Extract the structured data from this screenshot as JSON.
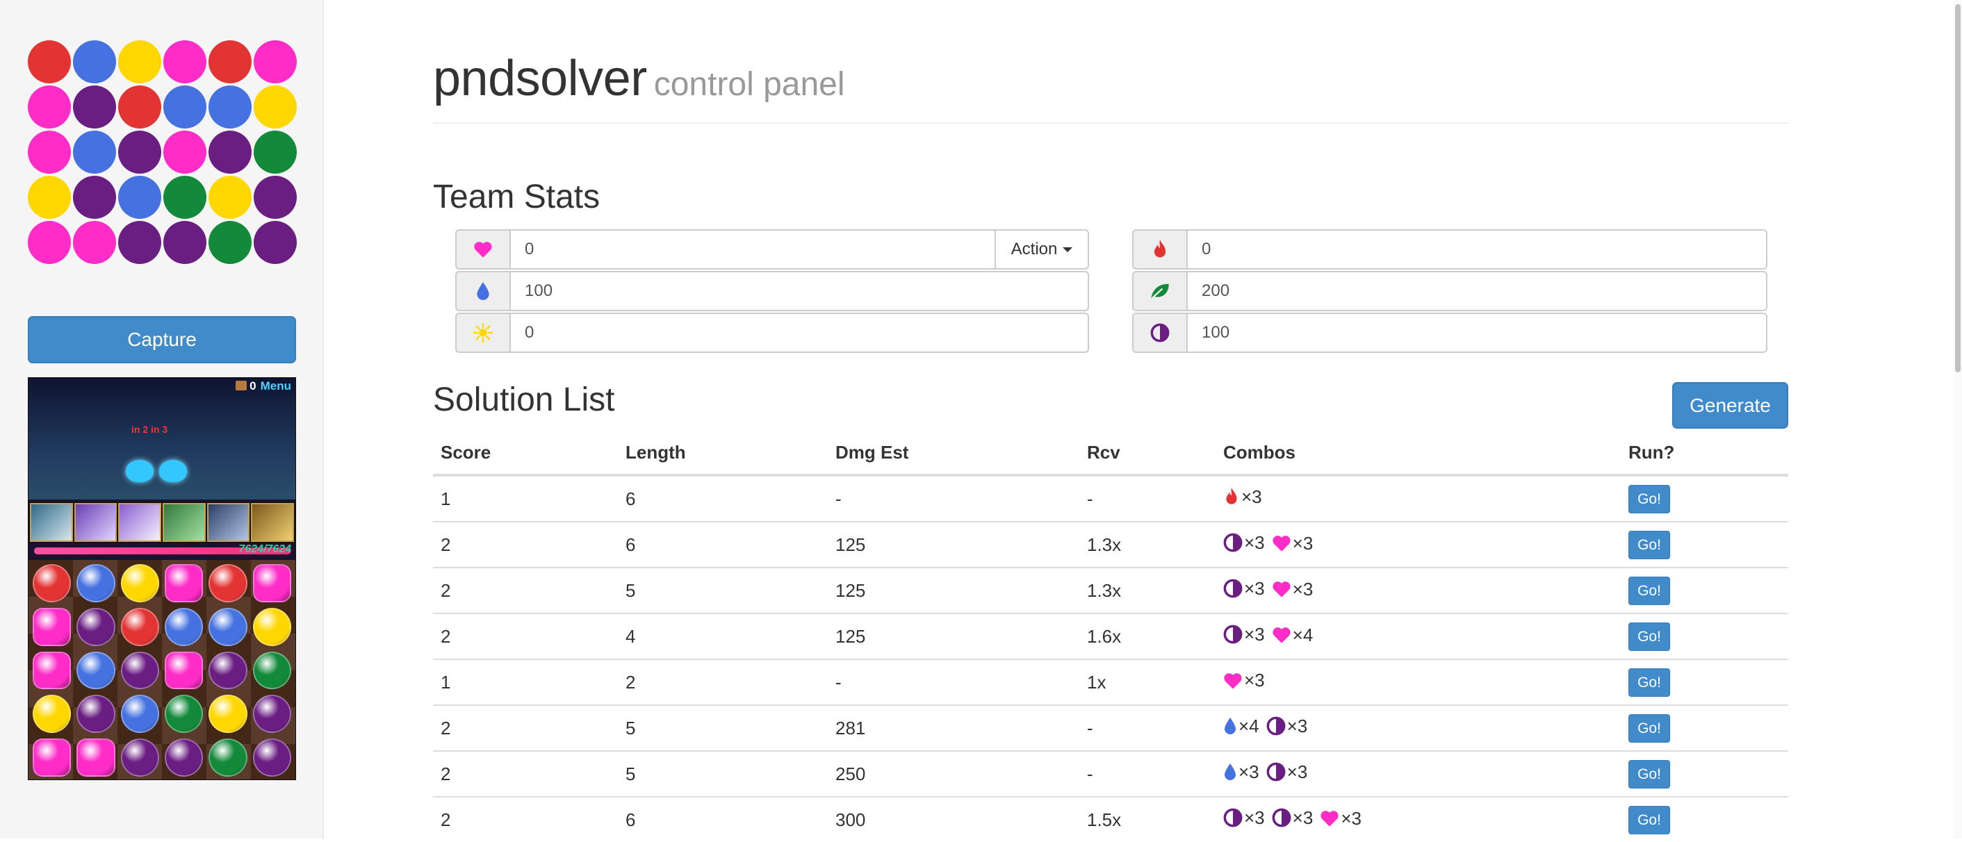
{
  "sidebar": {
    "orb_colors": [
      "#e33434",
      "#4572e0",
      "#ffd700",
      "#ff2cc8",
      "#e33434",
      "#ff2cc8",
      "#ff2cc8",
      "#6a1e82",
      "#e33434",
      "#4572e0",
      "#4572e0",
      "#ffd700",
      "#ff2cc8",
      "#4572e0",
      "#6a1e82",
      "#ff2cc8",
      "#6a1e82",
      "#138a3a",
      "#ffd700",
      "#6a1e82",
      "#4572e0",
      "#138a3a",
      "#ffd700",
      "#6a1e82",
      "#ff2cc8",
      "#ff2cc8",
      "#6a1e82",
      "#6a1e82",
      "#138a3a",
      "#6a1e82"
    ],
    "capture_label": "Capture",
    "game_screenshot": {
      "hud_count": "0",
      "hud_menu": "Menu",
      "damage_text": "in 2  in 3",
      "hp_text": "7624/7624",
      "board": [
        "fire",
        "water",
        "light",
        "heart",
        "fire",
        "heart",
        "heart",
        "dark",
        "fire",
        "water",
        "water",
        "light",
        "heart",
        "water",
        "dark",
        "heart",
        "dark",
        "wood",
        "light",
        "dark",
        "water",
        "wood",
        "light",
        "dark",
        "heart",
        "heart",
        "dark",
        "dark",
        "wood",
        "dark"
      ]
    }
  },
  "header": {
    "title": "pndsolver",
    "subtitle": "control panel"
  },
  "team_stats": {
    "heading": "Team Stats",
    "action_label": "Action",
    "stats": [
      {
        "icon": "heart-icon",
        "color": "#ff2cc8",
        "value": "0"
      },
      {
        "icon": "water-drop-icon",
        "color": "#4572e0",
        "value": "100"
      },
      {
        "icon": "light-sun-icon",
        "color": "#ffd700",
        "value": "0"
      },
      {
        "icon": "fire-icon",
        "color": "#e33434",
        "value": "0"
      },
      {
        "icon": "wood-leaf-icon",
        "color": "#138a3a",
        "value": "200"
      },
      {
        "icon": "dark-half-circle-icon",
        "color": "#6a1e82",
        "value": "100"
      }
    ]
  },
  "solutions": {
    "heading": "Solution List",
    "generate_label": "Generate",
    "columns": [
      "Score",
      "Length",
      "Dmg Est",
      "Rcv",
      "Combos",
      "Run?"
    ],
    "go_label": "Go!",
    "rows": [
      {
        "score": "1",
        "length": "6",
        "dmg": "-",
        "rcv": "-",
        "combos": [
          {
            "type": "fire",
            "count": "×3"
          }
        ]
      },
      {
        "score": "2",
        "length": "6",
        "dmg": "125",
        "rcv": "1.3x",
        "combos": [
          {
            "type": "dark",
            "count": "×3"
          },
          {
            "type": "heart",
            "count": "×3"
          }
        ]
      },
      {
        "score": "2",
        "length": "5",
        "dmg": "125",
        "rcv": "1.3x",
        "combos": [
          {
            "type": "dark",
            "count": "×3"
          },
          {
            "type": "heart",
            "count": "×3"
          }
        ]
      },
      {
        "score": "2",
        "length": "4",
        "dmg": "125",
        "rcv": "1.6x",
        "combos": [
          {
            "type": "dark",
            "count": "×3"
          },
          {
            "type": "heart",
            "count": "×4"
          }
        ]
      },
      {
        "score": "1",
        "length": "2",
        "dmg": "-",
        "rcv": "1x",
        "combos": [
          {
            "type": "heart",
            "count": "×3"
          }
        ]
      },
      {
        "score": "2",
        "length": "5",
        "dmg": "281",
        "rcv": "-",
        "combos": [
          {
            "type": "water",
            "count": "×4"
          },
          {
            "type": "dark",
            "count": "×3"
          }
        ]
      },
      {
        "score": "2",
        "length": "5",
        "dmg": "250",
        "rcv": "-",
        "combos": [
          {
            "type": "water",
            "count": "×3"
          },
          {
            "type": "dark",
            "count": "×3"
          }
        ]
      },
      {
        "score": "2",
        "length": "6",
        "dmg": "300",
        "rcv": "1.5x",
        "combos": [
          {
            "type": "dark",
            "count": "×3"
          },
          {
            "type": "dark",
            "count": "×3"
          },
          {
            "type": "heart",
            "count": "×3"
          }
        ]
      }
    ]
  },
  "element_colors": {
    "fire": "#e33434",
    "water": "#4572e0",
    "wood": "#138a3a",
    "light": "#ffd700",
    "dark": "#6a1e82",
    "heart": "#ff2cc8"
  }
}
